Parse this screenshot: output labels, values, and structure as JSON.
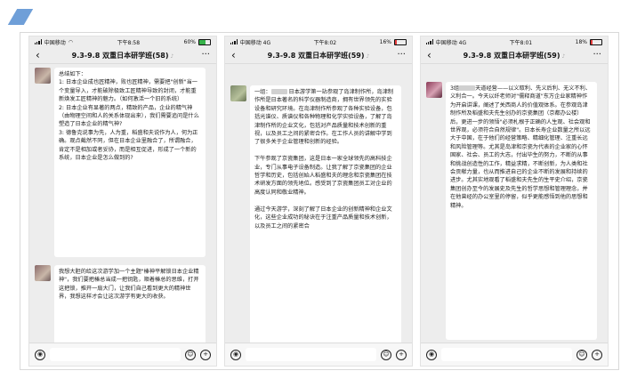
{
  "phones": [
    {
      "status": {
        "carrier": "中国移动",
        "time": "下午8:58",
        "right": "60%"
      },
      "title": "9.3-9.8 双重日本研学班(58)",
      "messages": [
        {
          "text": "总结如下：\n1: 日本企业成也匠精神，败也匠精神，需要把\"创新\"当一个变量导入，才能破除极致工匠精神导致的封闭，才能重新焕发工匠精神的魅力。（如何激活一个旧的系统）\n2: 日本企业有显著的两点，精致的产品，企业的精气神（由物理空间和人的关系体现出来），我们需要追问是什么塑造了日本企业的精气神?\n3: 德鲁克说事为先，人为重，稻盛和夫说作为人，何为正确。观点截然不同，但在日本企业里融合了，所谓融合，肯定不是相加或者妥协，而是相互促进，形成了一个新的系统，日本企业是怎么做到的?"
        },
        {
          "text": "我想大胆的给这次游学加一个主题\"榛神平解锁日本企业精神\"，我们要把榛总当成一把钥匙，顺着榛总的思维，打开这把锁，推开一扇大门，让我们自己看到更大的精神世界，我想这样才会让这次游学有更大的收获。"
        }
      ]
    },
    {
      "status": {
        "carrier": "中国移动 4G",
        "time": "下午8:02",
        "right": "16%"
      },
      "title": "9.3-9.8 双重日本研学班(59)",
      "messages": [
        {
          "text": "一组：[blur] 日本游学第一站参观了岛津制作所，岛津制作所是日本著名的科学仪器制造商，拥有世界领先的实验设备和研究环境。在岛津制作所参观了各种实验设备，包括光谱仪、质谱仪和各种物理和化学实验设备，了解了岛津制作所的企业文化，包括对产品质量和技术创新的重视，以及员工之间的紧密合作。在工作人员的讲解中学到了很多关于企业管理和创新的经验。\n\n下午参观了京瓷集团，这是日本一家全球领先的高科技企业，专门从事电子设备制造。让我了解了京瓷集团的企业哲学和历史，包括创始人稻盛和夫的理念和京瓷集团在技术研发方面的领先地位。感受到了京瓷集团员工对企业的高度认同和敬业精神。\n\n通过今天游学，深刻了解了日本企业的创新精神和企业文化，这些企业成功的秘诀在于注重产品质量和技术创新，以及员工之间的紧密合"
        }
      ]
    },
    {
      "status": {
        "carrier": "中国移动 4G",
        "time": "下午8:01",
        "right": "18%"
      },
      "title": "9.3-9.8 双重日本研学班(59)",
      "messages": [
        {
          "text": "3组[blur]天道经营——以义取利、先义后利、无义不利、义利合一。今天以纤老师对\"儒释商道\"东方企业家精神作为开启讲课，阐述了关西商人的价值观体系。在参观岛津制作所及稻盛和夫先生创办的京瓷集团（京都办公楼）后，更进一步的领悟\"必须札根于正确的人生观、社会观和世界观，必须符合自然规律\"。日本长寿企业数量之所以远大于中国，在于他们的经营策略、精细化管理、注重长远和风险管理等。尤其是岛津和京瓷为代表的企业家的心怀国家、社会、员工的大志，付出毕生的努力，不断的从事和挑战创造性的工作，精益求精，不断创新，为人类和社会贡献力量，也从而推进自己的企业不断的发展和持续的进步。尤其实地观看了稻盛和夫先生的生平史介绍，京瓷集团创办至今的发展史及先生的哲学思想和管理理念，并在他曾经的办公室里的停留，似乎更能感悟到他的思想和精神。"
        }
      ]
    }
  ]
}
